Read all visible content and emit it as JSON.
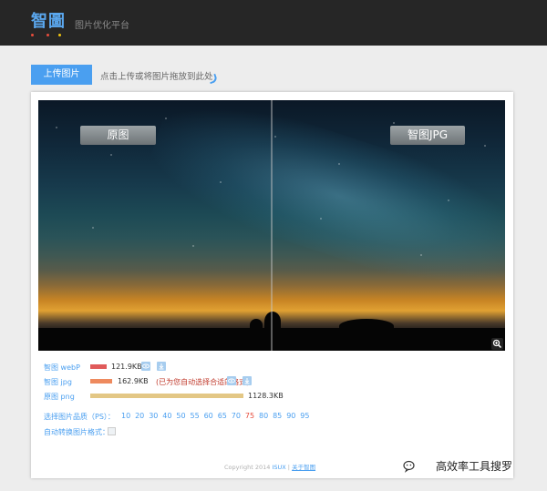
{
  "header": {
    "logo": "智圖",
    "tagline": "图片优化平台",
    "dot_colors": [
      "#e74c3c",
      "#e74c3c",
      "#f1c40f",
      "#3498db"
    ]
  },
  "upload": {
    "button_label": "上传图片",
    "hint": "点击上传或将图片拖放到此处"
  },
  "preview": {
    "left_label": "原图",
    "right_label": "智图JPG"
  },
  "formats": [
    {
      "name": "智图 webP",
      "size": "121.9KB",
      "bar_color": "#e05a5a",
      "bar_fraction": 0.108
    },
    {
      "name": "智图 jpg",
      "size": "162.9KB",
      "note": "(已为您自动选择合适的格式)",
      "bar_color": "#ee8a5e",
      "bar_fraction": 0.144
    },
    {
      "name": "原图 png",
      "size": "1128.3KB",
      "bar_color": "#e3c785",
      "bar_fraction": 1.0
    }
  ],
  "quality": {
    "label": "选择图片品质（PS）：",
    "options": [
      "10",
      "20",
      "30",
      "40",
      "50",
      "55",
      "60",
      "65",
      "70",
      "75",
      "80",
      "85",
      "90",
      "95"
    ],
    "selected": "75",
    "selected_color": "#e74c3c"
  },
  "convert": {
    "label": "自动转换图片格式："
  },
  "footer": {
    "copyright": "Copyright 2014",
    "brand": "ISUX",
    "separator": "|",
    "about": "关于智图"
  },
  "watermark": {
    "text": "高效率工具搜罗"
  }
}
